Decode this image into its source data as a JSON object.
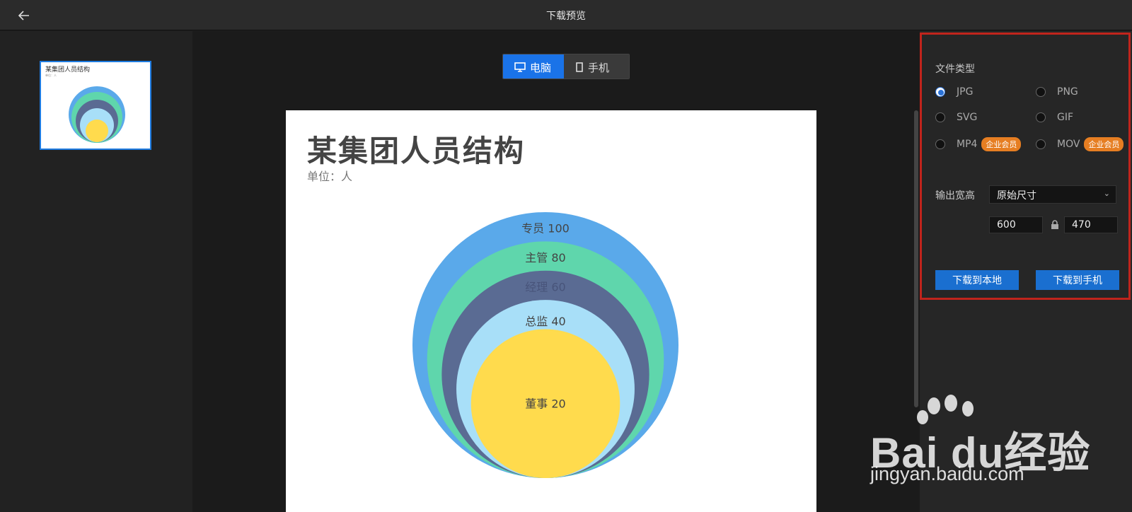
{
  "header": {
    "title": "下载预览"
  },
  "thumbnail": {
    "title": "某集团人员结构",
    "subtitle": "单位：人"
  },
  "device_tabs": [
    {
      "label": "电脑",
      "icon": "monitor-icon",
      "active": true
    },
    {
      "label": "手机",
      "icon": "phone-icon",
      "active": false
    }
  ],
  "chart": {
    "title": "某集团人员结构",
    "subtitle": "单位：人"
  },
  "chart_data": {
    "type": "nested-circles",
    "title": "某集团人员结构",
    "subtitle": "单位：人",
    "categories": [
      "专员",
      "主管",
      "经理",
      "总监",
      "董事"
    ],
    "values": [
      100,
      80,
      60,
      40,
      20
    ],
    "colors": [
      "#5aa9ea",
      "#5fd6ac",
      "#5a6b93",
      "#a8dff8",
      "#ffdb4d"
    ]
  },
  "settings": {
    "file_type_label": "文件类型",
    "file_types": [
      {
        "label": "JPG",
        "checked": true,
        "badge": ""
      },
      {
        "label": "PNG",
        "checked": false,
        "badge": ""
      },
      {
        "label": "SVG",
        "checked": false,
        "badge": ""
      },
      {
        "label": "GIF",
        "checked": false,
        "badge": ""
      },
      {
        "label": "MP4",
        "checked": false,
        "badge": "企业会员"
      },
      {
        "label": "MOV",
        "checked": false,
        "badge": "企业会员"
      }
    ],
    "output_size_label": "输出宽高",
    "size_option": "原始尺寸",
    "width": "600",
    "height": "470",
    "download_local": "下载到本地",
    "download_phone": "下载到手机"
  },
  "watermark": {
    "brand": "Bai du经验",
    "url": "jingyan.baidu.com"
  },
  "colors": {
    "accent": "#1a73e8",
    "highlight_border": "#c0241c",
    "badge": "#e67e22"
  }
}
